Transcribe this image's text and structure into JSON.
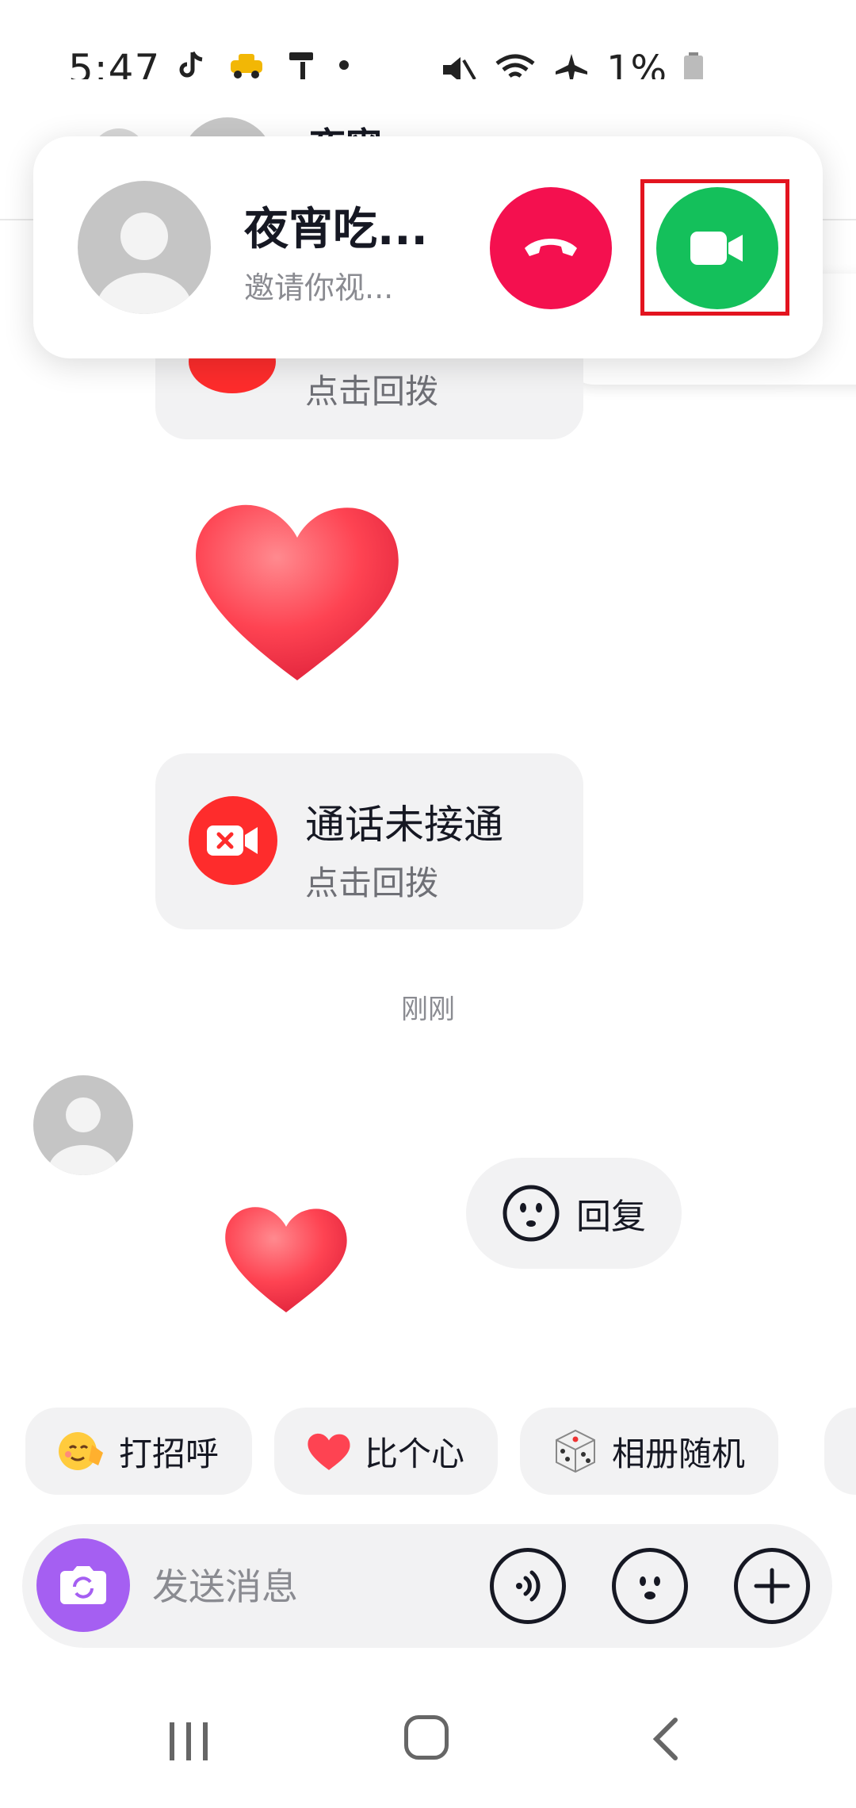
{
  "status_bar": {
    "time": "5:47",
    "battery": "1%"
  },
  "header": {
    "contact_name": "夜宵"
  },
  "incoming_call": {
    "caller_name": "夜宵吃...",
    "caller_subtitle": "邀请你视...",
    "decline_icon": "phone-hangup-icon",
    "accept_icon": "video-camera-icon"
  },
  "chat": {
    "missed_call_1": {
      "subtitle": "点击回拨"
    },
    "missed_call_2": {
      "title": "通话未接通",
      "subtitle": "点击回拨"
    },
    "timestamp": "刚刚",
    "reply_label": "回复"
  },
  "quick_actions": [
    {
      "label": "打招呼",
      "icon": "wave-emoji-icon"
    },
    {
      "label": "比个心",
      "icon": "heart-icon"
    },
    {
      "label": "相册随机",
      "icon": "dice-icon"
    }
  ],
  "input_bar": {
    "placeholder": "发送消息"
  },
  "colors": {
    "decline": "#f4104f",
    "accept": "#14c05b",
    "missed": "#fe2c2c",
    "camera": "#a55ff2",
    "highlight": "#e3141f"
  }
}
